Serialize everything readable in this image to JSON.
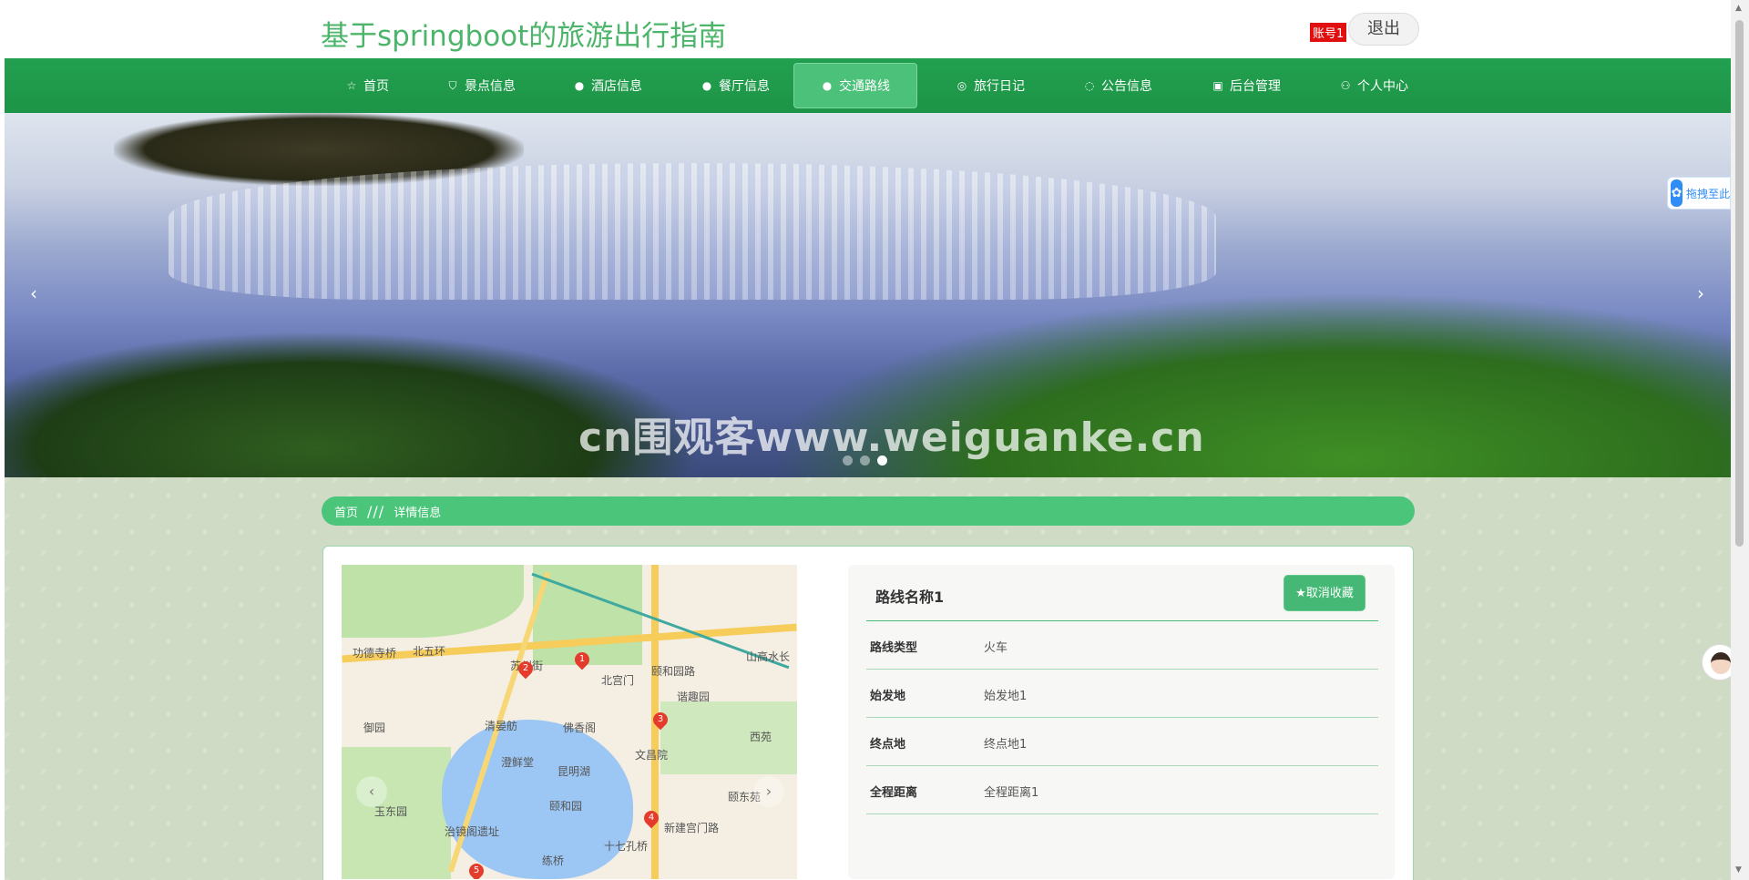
{
  "header": {
    "site_title": "基于springboot的旅游出行指南",
    "user_tag": "账号1",
    "logout_label": "退出"
  },
  "nav": {
    "items": [
      {
        "label": "首页",
        "icon": "star-icon"
      },
      {
        "label": "景点信息",
        "icon": "bag-icon"
      },
      {
        "label": "酒店信息",
        "icon": "info-icon"
      },
      {
        "label": "餐厅信息",
        "icon": "question-icon"
      },
      {
        "label": "交通路线",
        "icon": "info-icon",
        "active": true
      },
      {
        "label": "旅行日记",
        "icon": "target-icon"
      },
      {
        "label": "公告信息",
        "icon": "check-circle-icon"
      },
      {
        "label": "后台管理",
        "icon": "clipboard-icon"
      },
      {
        "label": "个人中心",
        "icon": "user-icon"
      }
    ]
  },
  "banner": {
    "watermark": "cn围观客www.weiguanke.cn",
    "slide_count": 3,
    "active_slide": 3
  },
  "breadcrumb": {
    "home": "首页",
    "separator": "///",
    "current": "详情信息"
  },
  "map": {
    "labels": [
      "功德寺桥",
      "北五环",
      "苏州街",
      "北宫门",
      "颐和园路",
      "山高水长",
      "谐趣园",
      "佛香阁",
      "清晏舫",
      "御园",
      "西苑",
      "澄鲜堂",
      "文昌院",
      "昆明湖",
      "颐和园",
      "颐东苑",
      "玉东园",
      "治镜阁遗址",
      "新建宫门路",
      "十七孔桥",
      "练桥"
    ],
    "pins": [
      "1",
      "2",
      "3",
      "4",
      "5"
    ]
  },
  "detail": {
    "title": "路线名称1",
    "favorite_label": "★取消收藏",
    "rows": [
      {
        "key": "路线类型",
        "value": "火车"
      },
      {
        "key": "始发地",
        "value": "始发地1"
      },
      {
        "key": "终点地",
        "value": "终点地1"
      },
      {
        "key": "全程距离",
        "value": "全程距离1"
      }
    ]
  },
  "widgets": {
    "drag_text": "拖拽至此"
  },
  "colors": {
    "brand_green": "#1d9447",
    "accent_green": "#4bc57a",
    "title_green": "#4cb56a"
  }
}
